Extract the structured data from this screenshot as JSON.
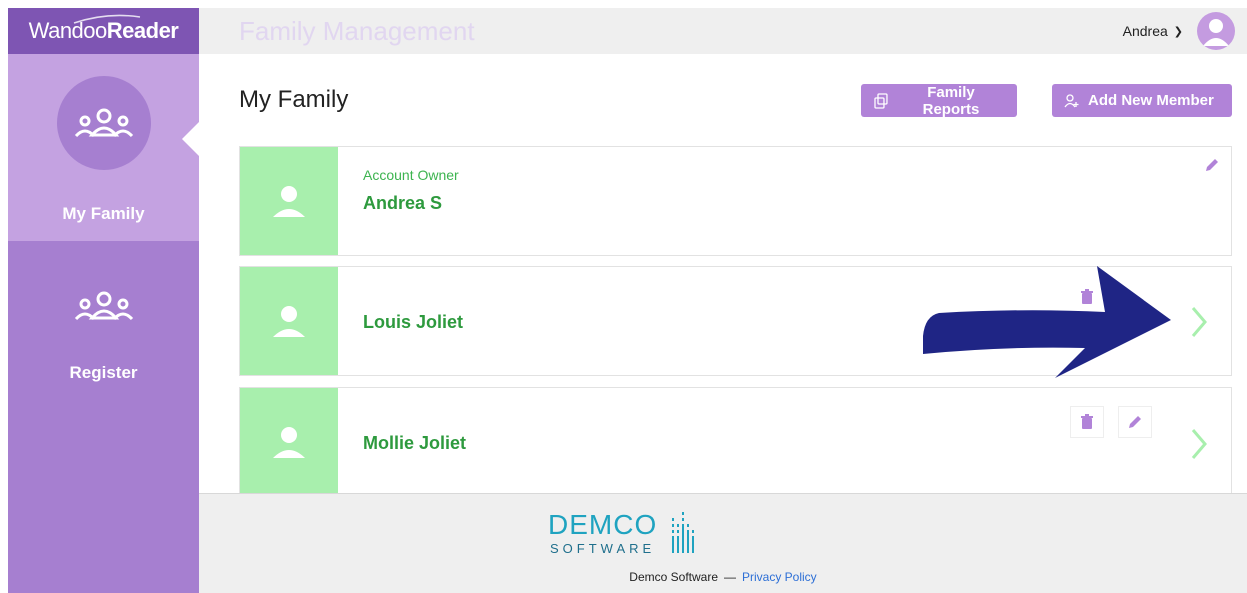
{
  "brand": {
    "name_light": "Wandoo",
    "name_bold": "Reader"
  },
  "sidebar": {
    "items": [
      {
        "label": "My Family",
        "icon": "family-group-icon",
        "active": true
      },
      {
        "label": "Register",
        "icon": "family-group-icon",
        "active": false
      }
    ]
  },
  "topbar": {
    "page_title": "Family Management",
    "user_name": "Andrea",
    "user_menu_icon": "chevron-down-icon"
  },
  "main": {
    "heading": "My Family",
    "buttons": {
      "reports_label": "Family Reports",
      "add_member_label": "Add New Member"
    },
    "members": [
      {
        "role": "Account Owner",
        "name": "Andrea S",
        "actions": [
          "edit"
        ]
      },
      {
        "name": "Louis Joliet",
        "actions": [
          "delete",
          "edit",
          "open"
        ]
      },
      {
        "name": "Mollie Joliet",
        "actions": [
          "delete",
          "edit",
          "open"
        ]
      }
    ]
  },
  "footer": {
    "logo_top": "DEMCO",
    "logo_bottom": "SOFTWARE",
    "company": "Demco Software",
    "separator": "—",
    "privacy_link": "Privacy Policy"
  },
  "colors": {
    "sidebar": "#a67fd0",
    "sidebar_active": "#c4a2e1",
    "brand_bar": "#7e55b3",
    "button": "#b183d8",
    "avatar_green": "#a8efad",
    "name_green": "#2e9a3e",
    "link_blue": "#2d6fd6",
    "annotation_arrow": "#1f2585"
  }
}
